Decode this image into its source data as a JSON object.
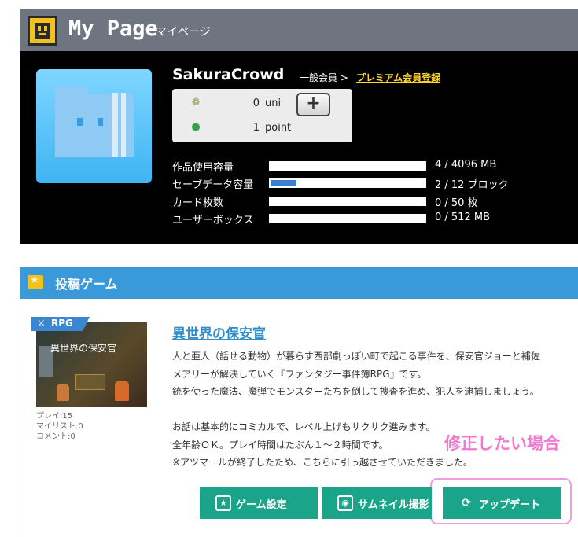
{
  "header": {
    "title": "My Page",
    "subtitle": "マイページ",
    "logo_icon": "pixel-face-icon"
  },
  "profile": {
    "username": "SakuraCrowd",
    "member_status": "一般会員 >",
    "premium_link": "プレミアム会員登録",
    "avatar_icon": "folder-face-icon",
    "wallet": {
      "uni_value": "0",
      "uni_unit": "uni",
      "point_value": "1",
      "point_unit": "point",
      "add_label": "+"
    },
    "stats": [
      {
        "label": "作品使用容量",
        "value": "4 / 4096 MB",
        "fraction": 0.001
      },
      {
        "label": "セーブデータ容量",
        "value": "2 / 12 ブロック",
        "fraction": 0.167
      },
      {
        "label": "カード枚数",
        "value": "0 / 50 枚",
        "fraction": 0
      },
      {
        "label": "ユーザーボックス",
        "value": "0 / 512 MB",
        "fraction": 0
      }
    ]
  },
  "games_section": {
    "title": "投稿ゲーム",
    "game": {
      "genre": "RPG",
      "thumbnail_caption": "異世界の保安官",
      "title": "異世界の保安官",
      "plays": "プレイ:15",
      "mylist": "マイリスト:0",
      "comments": "コメント:0",
      "description": [
        "人と亜人（話せる動物）が暮らす西部劇っぽい町で起こる事件を、保安官ジョーと補佐",
        "メアリーが解決していく『ファンタジー事件簿RPG』です。",
        "銃を使った魔法、魔弾でモンスターたちを倒して捜査を進め、犯人を逮捕しましょう。",
        "",
        "お話は基本的にコミカルで、レベル上げもサクサク進みます。",
        "全年齢ＯＫ。プレイ時間はたぶん１～２時間です。",
        "※アツマールが終了したため、こちらに引っ越させていただきました。"
      ]
    },
    "buttons": {
      "settings": "ゲーム設定",
      "thumbnail": "サムネイル撮影",
      "update": "アップデート"
    }
  },
  "annotation": "修正したい場合",
  "colors": {
    "header_bg": "#6e7480",
    "section_blue": "#3a9ad9",
    "button_green": "#1aa58a",
    "annotation_pink": "#f07ad2",
    "premium_yellow": "#ffd42a"
  }
}
